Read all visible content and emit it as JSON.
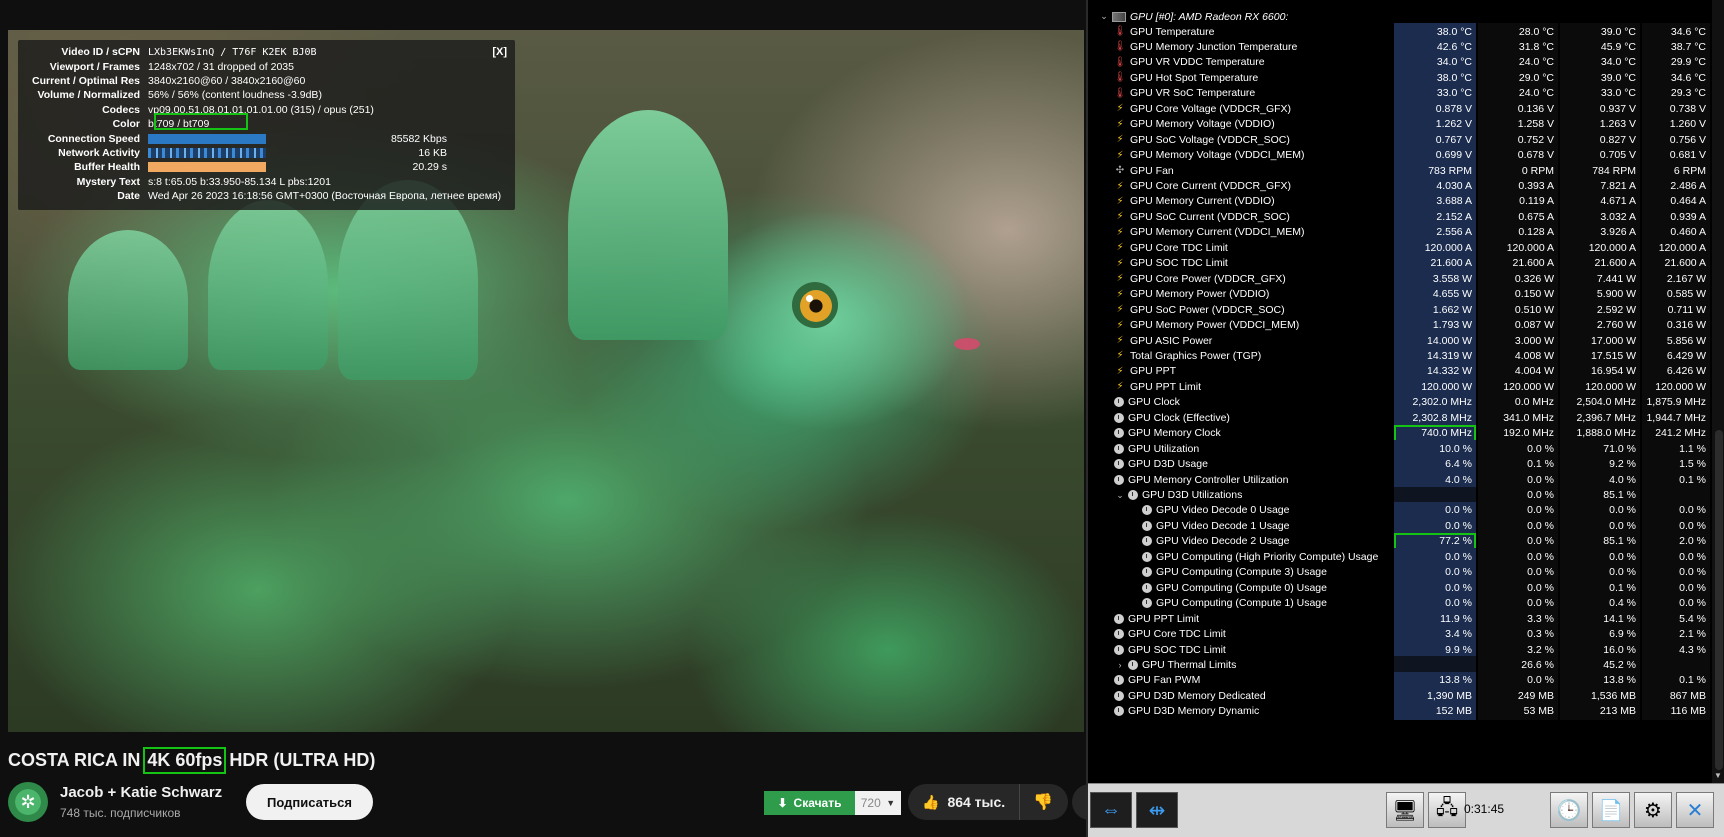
{
  "stats": {
    "close_label": "[X]",
    "rows": [
      {
        "label": "Video ID / sCPN",
        "value": "LXb3EKWsInQ / T76F K2EK BJ0B",
        "mono": true
      },
      {
        "label": "Viewport / Frames",
        "value": "1248x702 / 31 dropped of 2035"
      },
      {
        "label": "Current / Optimal Res",
        "value": "3840x2160@60 / 3840x2160@60"
      },
      {
        "label": "Volume / Normalized",
        "value": "56% / 56% (content loudness -3.9dB)"
      },
      {
        "label": "Codecs",
        "value": "vp09.00.51.08.01.01.01.01.00 (315) / opus (251)"
      },
      {
        "label": "Color",
        "value": "bt709 / bt709"
      },
      {
        "label": "Connection Speed",
        "value": "85582 Kbps",
        "bar": "conn",
        "fill": 1.0
      },
      {
        "label": "Network Activity",
        "value": "16 KB",
        "bar": "net",
        "fill": 1.0
      },
      {
        "label": "Buffer Health",
        "value": "20.29 s",
        "bar": "buf",
        "fill": 1.0
      },
      {
        "label": "Mystery Text",
        "value": "s:8 t:65.05 b:33.950-85.134 L pbs:1201"
      },
      {
        "label": "Date",
        "value": "Wed Apr 26 2023 16:18:56 GMT+0300 (Восточная Европа, летнее время)"
      }
    ]
  },
  "video": {
    "title_before": "COSTA RICA IN",
    "title_highlight": "4K 60fps",
    "title_after": "HDR (ULTRA HD)",
    "channel_name": "Jacob + Katie Schwarz",
    "channel_subs": "748 тыс. подписчиков",
    "subscribe_label": "Подписаться",
    "download_label": "Скачать",
    "quality_value": "720",
    "likes": "864 тыс."
  },
  "sensors": {
    "header": "GPU [#0]: AMD Radeon RX 6600:",
    "rows": [
      {
        "name": "GPU Temperature",
        "icon": "temp",
        "cur": "38.0 °C",
        "min": "28.0 °C",
        "max": "39.0 °C",
        "avg": "34.6 °C"
      },
      {
        "name": "GPU Memory Junction Temperature",
        "icon": "temp",
        "cur": "42.6 °C",
        "min": "31.8 °C",
        "max": "45.9 °C",
        "avg": "38.7 °C"
      },
      {
        "name": "GPU VR VDDC Temperature",
        "icon": "temp",
        "cur": "34.0 °C",
        "min": "24.0 °C",
        "max": "34.0 °C",
        "avg": "29.9 °C"
      },
      {
        "name": "GPU Hot Spot Temperature",
        "icon": "temp",
        "cur": "38.0 °C",
        "min": "29.0 °C",
        "max": "39.0 °C",
        "avg": "34.6 °C"
      },
      {
        "name": "GPU VR SoC Temperature",
        "icon": "temp",
        "cur": "33.0 °C",
        "min": "24.0 °C",
        "max": "33.0 °C",
        "avg": "29.3 °C"
      },
      {
        "name": "GPU Core Voltage (VDDCR_GFX)",
        "icon": "volt",
        "cur": "0.878 V",
        "min": "0.136 V",
        "max": "0.937 V",
        "avg": "0.738 V"
      },
      {
        "name": "GPU Memory Voltage (VDDIO)",
        "icon": "volt",
        "cur": "1.262 V",
        "min": "1.258 V",
        "max": "1.263 V",
        "avg": "1.260 V"
      },
      {
        "name": "GPU SoC Voltage (VDDCR_SOC)",
        "icon": "volt",
        "cur": "0.767 V",
        "min": "0.752 V",
        "max": "0.827 V",
        "avg": "0.756 V"
      },
      {
        "name": "GPU Memory Voltage (VDDCI_MEM)",
        "icon": "volt",
        "cur": "0.699 V",
        "min": "0.678 V",
        "max": "0.705 V",
        "avg": "0.681 V"
      },
      {
        "name": "GPU Fan",
        "icon": "fan",
        "cur": "783 RPM",
        "min": "0 RPM",
        "max": "784 RPM",
        "avg": "6 RPM"
      },
      {
        "name": "GPU Core Current (VDDCR_GFX)",
        "icon": "volt",
        "cur": "4.030 A",
        "min": "0.393 A",
        "max": "7.821 A",
        "avg": "2.486 A"
      },
      {
        "name": "GPU Memory Current (VDDIO)",
        "icon": "volt",
        "cur": "3.688 A",
        "min": "0.119 A",
        "max": "4.671 A",
        "avg": "0.464 A"
      },
      {
        "name": "GPU SoC Current (VDDCR_SOC)",
        "icon": "volt",
        "cur": "2.152 A",
        "min": "0.675 A",
        "max": "3.032 A",
        "avg": "0.939 A"
      },
      {
        "name": "GPU Memory Current (VDDCI_MEM)",
        "icon": "volt",
        "cur": "2.556 A",
        "min": "0.128 A",
        "max": "3.926 A",
        "avg": "0.460 A"
      },
      {
        "name": "GPU Core TDC Limit",
        "icon": "volt",
        "cur": "120.000 A",
        "min": "120.000 A",
        "max": "120.000 A",
        "avg": "120.000 A"
      },
      {
        "name": "GPU SOC TDC Limit",
        "icon": "volt",
        "cur": "21.600 A",
        "min": "21.600 A",
        "max": "21.600 A",
        "avg": "21.600 A"
      },
      {
        "name": "GPU Core Power (VDDCR_GFX)",
        "icon": "volt",
        "cur": "3.558 W",
        "min": "0.326 W",
        "max": "7.441 W",
        "avg": "2.167 W"
      },
      {
        "name": "GPU Memory Power (VDDIO)",
        "icon": "volt",
        "cur": "4.655 W",
        "min": "0.150 W",
        "max": "5.900 W",
        "avg": "0.585 W"
      },
      {
        "name": "GPU SoC Power (VDDCR_SOC)",
        "icon": "volt",
        "cur": "1.662 W",
        "min": "0.510 W",
        "max": "2.592 W",
        "avg": "0.711 W"
      },
      {
        "name": "GPU Memory Power (VDDCI_MEM)",
        "icon": "volt",
        "cur": "1.793 W",
        "min": "0.087 W",
        "max": "2.760 W",
        "avg": "0.316 W"
      },
      {
        "name": "GPU ASIC Power",
        "icon": "volt",
        "cur": "14.000 W",
        "min": "3.000 W",
        "max": "17.000 W",
        "avg": "5.856 W"
      },
      {
        "name": "Total Graphics Power (TGP)",
        "icon": "volt",
        "cur": "14.319 W",
        "min": "4.008 W",
        "max": "17.515 W",
        "avg": "6.429 W"
      },
      {
        "name": "GPU PPT",
        "icon": "volt",
        "cur": "14.332 W",
        "min": "4.004 W",
        "max": "16.954 W",
        "avg": "6.426 W"
      },
      {
        "name": "GPU PPT Limit",
        "icon": "volt",
        "cur": "120.000 W",
        "min": "120.000 W",
        "max": "120.000 W",
        "avg": "120.000 W"
      },
      {
        "name": "GPU Clock",
        "icon": "clock",
        "cur": "2,302.0 MHz",
        "min": "0.0 MHz",
        "max": "2,504.0 MHz",
        "avg": "1,875.9 MHz"
      },
      {
        "name": "GPU Clock (Effective)",
        "icon": "clock",
        "cur": "2,302.8 MHz",
        "min": "341.0 MHz",
        "max": "2,396.7 MHz",
        "avg": "1,944.7 MHz"
      },
      {
        "name": "GPU Memory Clock",
        "icon": "clock",
        "cur": "740.0 MHz",
        "min": "192.0 MHz",
        "max": "1,888.0 MHz",
        "avg": "241.2 MHz",
        "hl": true
      },
      {
        "name": "GPU Utilization",
        "icon": "clock",
        "cur": "10.0 %",
        "min": "0.0 %",
        "max": "71.0 %",
        "avg": "1.1 %"
      },
      {
        "name": "GPU D3D Usage",
        "icon": "clock",
        "cur": "6.4 %",
        "min": "0.1 %",
        "max": "9.2 %",
        "avg": "1.5 %"
      },
      {
        "name": "GPU Memory Controller Utilization",
        "icon": "clock",
        "cur": "4.0 %",
        "min": "0.0 %",
        "max": "4.0 %",
        "avg": "0.1 %"
      },
      {
        "name": "GPU D3D Utilizations",
        "icon": "clock",
        "indent": 1,
        "chev": "⌄",
        "cur": "",
        "min": "0.0 %",
        "max": "85.1 %",
        "avg": ""
      },
      {
        "name": "GPU Video Decode 0 Usage",
        "icon": "clock",
        "indent": 2,
        "cur": "0.0 %",
        "min": "0.0 %",
        "max": "0.0 %",
        "avg": "0.0 %"
      },
      {
        "name": "GPU Video Decode 1 Usage",
        "icon": "clock",
        "indent": 2,
        "cur": "0.0 %",
        "min": "0.0 %",
        "max": "0.0 %",
        "avg": "0.0 %"
      },
      {
        "name": "GPU Video Decode 2 Usage",
        "icon": "clock",
        "indent": 2,
        "cur": "77.2 %",
        "min": "0.0 %",
        "max": "85.1 %",
        "avg": "2.0 %",
        "hl": true
      },
      {
        "name": "GPU Computing (High Priority Compute) Usage",
        "icon": "clock",
        "indent": 2,
        "cur": "0.0 %",
        "min": "0.0 %",
        "max": "0.0 %",
        "avg": "0.0 %"
      },
      {
        "name": "GPU Computing (Compute 3) Usage",
        "icon": "clock",
        "indent": 2,
        "cur": "0.0 %",
        "min": "0.0 %",
        "max": "0.0 %",
        "avg": "0.0 %"
      },
      {
        "name": "GPU Computing (Compute 0) Usage",
        "icon": "clock",
        "indent": 2,
        "cur": "0.0 %",
        "min": "0.0 %",
        "max": "0.1 %",
        "avg": "0.0 %"
      },
      {
        "name": "GPU Computing (Compute 1) Usage",
        "icon": "clock",
        "indent": 2,
        "cur": "0.0 %",
        "min": "0.0 %",
        "max": "0.4 %",
        "avg": "0.0 %"
      },
      {
        "name": "GPU PPT Limit",
        "icon": "clock",
        "cur": "11.9 %",
        "min": "3.3 %",
        "max": "14.1 %",
        "avg": "5.4 %"
      },
      {
        "name": "GPU Core TDC Limit",
        "icon": "clock",
        "cur": "3.4 %",
        "min": "0.3 %",
        "max": "6.9 %",
        "avg": "2.1 %"
      },
      {
        "name": "GPU SOC TDC Limit",
        "icon": "clock",
        "cur": "9.9 %",
        "min": "3.2 %",
        "max": "16.0 %",
        "avg": "4.3 %"
      },
      {
        "name": "GPU Thermal Limits",
        "icon": "clock",
        "indent": 1,
        "chev": "›",
        "cur": "",
        "min": "26.6 %",
        "max": "45.2 %",
        "avg": ""
      },
      {
        "name": "GPU Fan PWM",
        "icon": "clock",
        "cur": "13.8 %",
        "min": "0.0 %",
        "max": "13.8 %",
        "avg": "0.1 %"
      },
      {
        "name": "GPU D3D Memory Dedicated",
        "icon": "clock",
        "cur": "1,390 MB",
        "min": "249 MB",
        "max": "1,536 MB",
        "avg": "867 MB"
      },
      {
        "name": "GPU D3D Memory Dynamic",
        "icon": "clock",
        "cur": "152 MB",
        "min": "53 MB",
        "max": "213 MB",
        "avg": "116 MB"
      }
    ],
    "timer": "0:31:45"
  }
}
